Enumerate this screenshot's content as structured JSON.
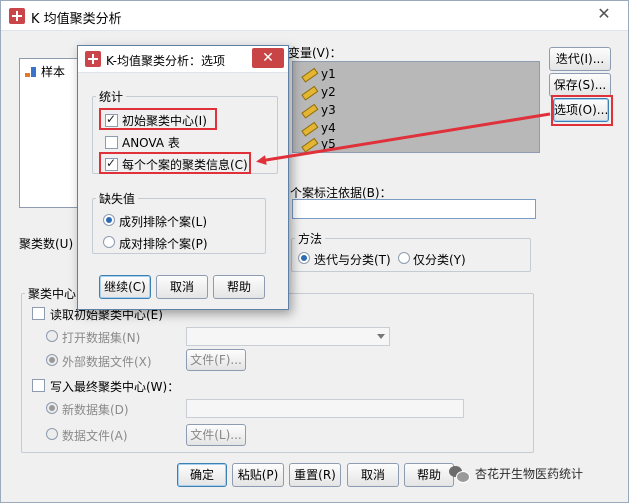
{
  "main_window": {
    "title": "K 均值聚类分析",
    "close_glyph": "✕",
    "variable_list": [
      {
        "name": "样本"
      }
    ],
    "variables_label": "变量(V)：",
    "selected_variables": [
      "y1",
      "y2",
      "y3",
      "y4",
      "y5"
    ],
    "case_label_label": "个案标注依据(B)：",
    "clusters_label": "聚类数(U)",
    "method": {
      "title": "方法",
      "options": [
        {
          "label": "迭代与分类(T)",
          "selected": true
        },
        {
          "label": "仅分类(Y)",
          "selected": false
        }
      ]
    },
    "side_buttons": [
      "迭代(I)...",
      "保存(S)...",
      "选项(O)..."
    ],
    "cluster_centers": {
      "title": "聚类中心",
      "read_initial_label": "读取初始聚类中心(E)",
      "read_options": [
        {
          "label": "打开数据集(N)",
          "selected": false
        },
        {
          "label": "外部数据文件(X)",
          "selected": true
        }
      ],
      "file_button": "文件(F)...",
      "write_final_label": "写入最终聚类中心(W)：",
      "write_options": [
        {
          "label": "新数据集(D)",
          "selected": true
        },
        {
          "label": "数据文件(A)",
          "selected": false
        }
      ],
      "file_button2": "文件(L)..."
    },
    "bottom_buttons": [
      "确定",
      "粘贴(P)",
      "重置(R)",
      "取消",
      "帮助"
    ]
  },
  "options_dialog": {
    "title": "K-均值聚类分析：选项",
    "close_glyph": "✕",
    "statistics": {
      "title": "统计",
      "items": [
        {
          "label": "初始聚类中心(I)",
          "checked": true
        },
        {
          "label": "ANOVA 表",
          "checked": false
        },
        {
          "label": "每个个案的聚类信息(C)",
          "checked": true
        }
      ]
    },
    "missing": {
      "title": "缺失值",
      "options": [
        {
          "label": "成列排除个案(L)",
          "selected": true
        },
        {
          "label": "成对排除个案(P)",
          "selected": false
        }
      ]
    },
    "buttons": [
      "继续(C)",
      "取消",
      "帮助"
    ]
  },
  "watermark": {
    "text": "杏花开生物医药统计",
    "icon": "wechat-icon"
  },
  "colors": {
    "highlight_red": "#e0303a",
    "focus_blue": "#3c7fb1",
    "selected_vars_bg": "#b8b8b8"
  }
}
